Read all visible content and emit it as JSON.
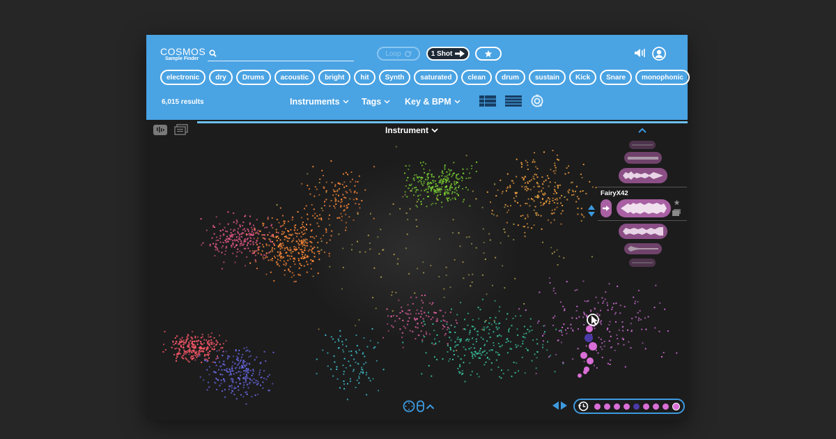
{
  "app": {
    "name": "COSMOS",
    "subtitle": "Sample Finder"
  },
  "header": {
    "search": {
      "placeholder": "",
      "value": ""
    },
    "buttons": {
      "loop": "Loop",
      "one_shot": "1 Shot"
    },
    "tags": [
      "electronic",
      "dry",
      "Drums",
      "acoustic",
      "bright",
      "hit",
      "Synth",
      "saturated",
      "clean",
      "drum",
      "sustain",
      "Kick",
      "Snare",
      "monophonic"
    ],
    "results": "6,015 results",
    "filters": {
      "instruments": "Instruments",
      "tags": "Tags",
      "key_bpm": "Key & BPM"
    }
  },
  "map": {
    "group_by": "Instrument",
    "colors": {
      "accent": "#4aa3e3",
      "clusters": [
        "#ff5a6a",
        "#6a6ae8",
        "#ff8a3a",
        "#e85a8a",
        "#f0a040",
        "#7ad032",
        "#e060a0",
        "#3ac8a0",
        "#40c0d0",
        "#d070d8"
      ]
    }
  },
  "side_panel": {
    "selected_sample": "FairyX42"
  },
  "history": {
    "dots": [
      "pink",
      "pink",
      "pink",
      "pink",
      "blue",
      "pink",
      "pink",
      "pink",
      "current"
    ]
  }
}
